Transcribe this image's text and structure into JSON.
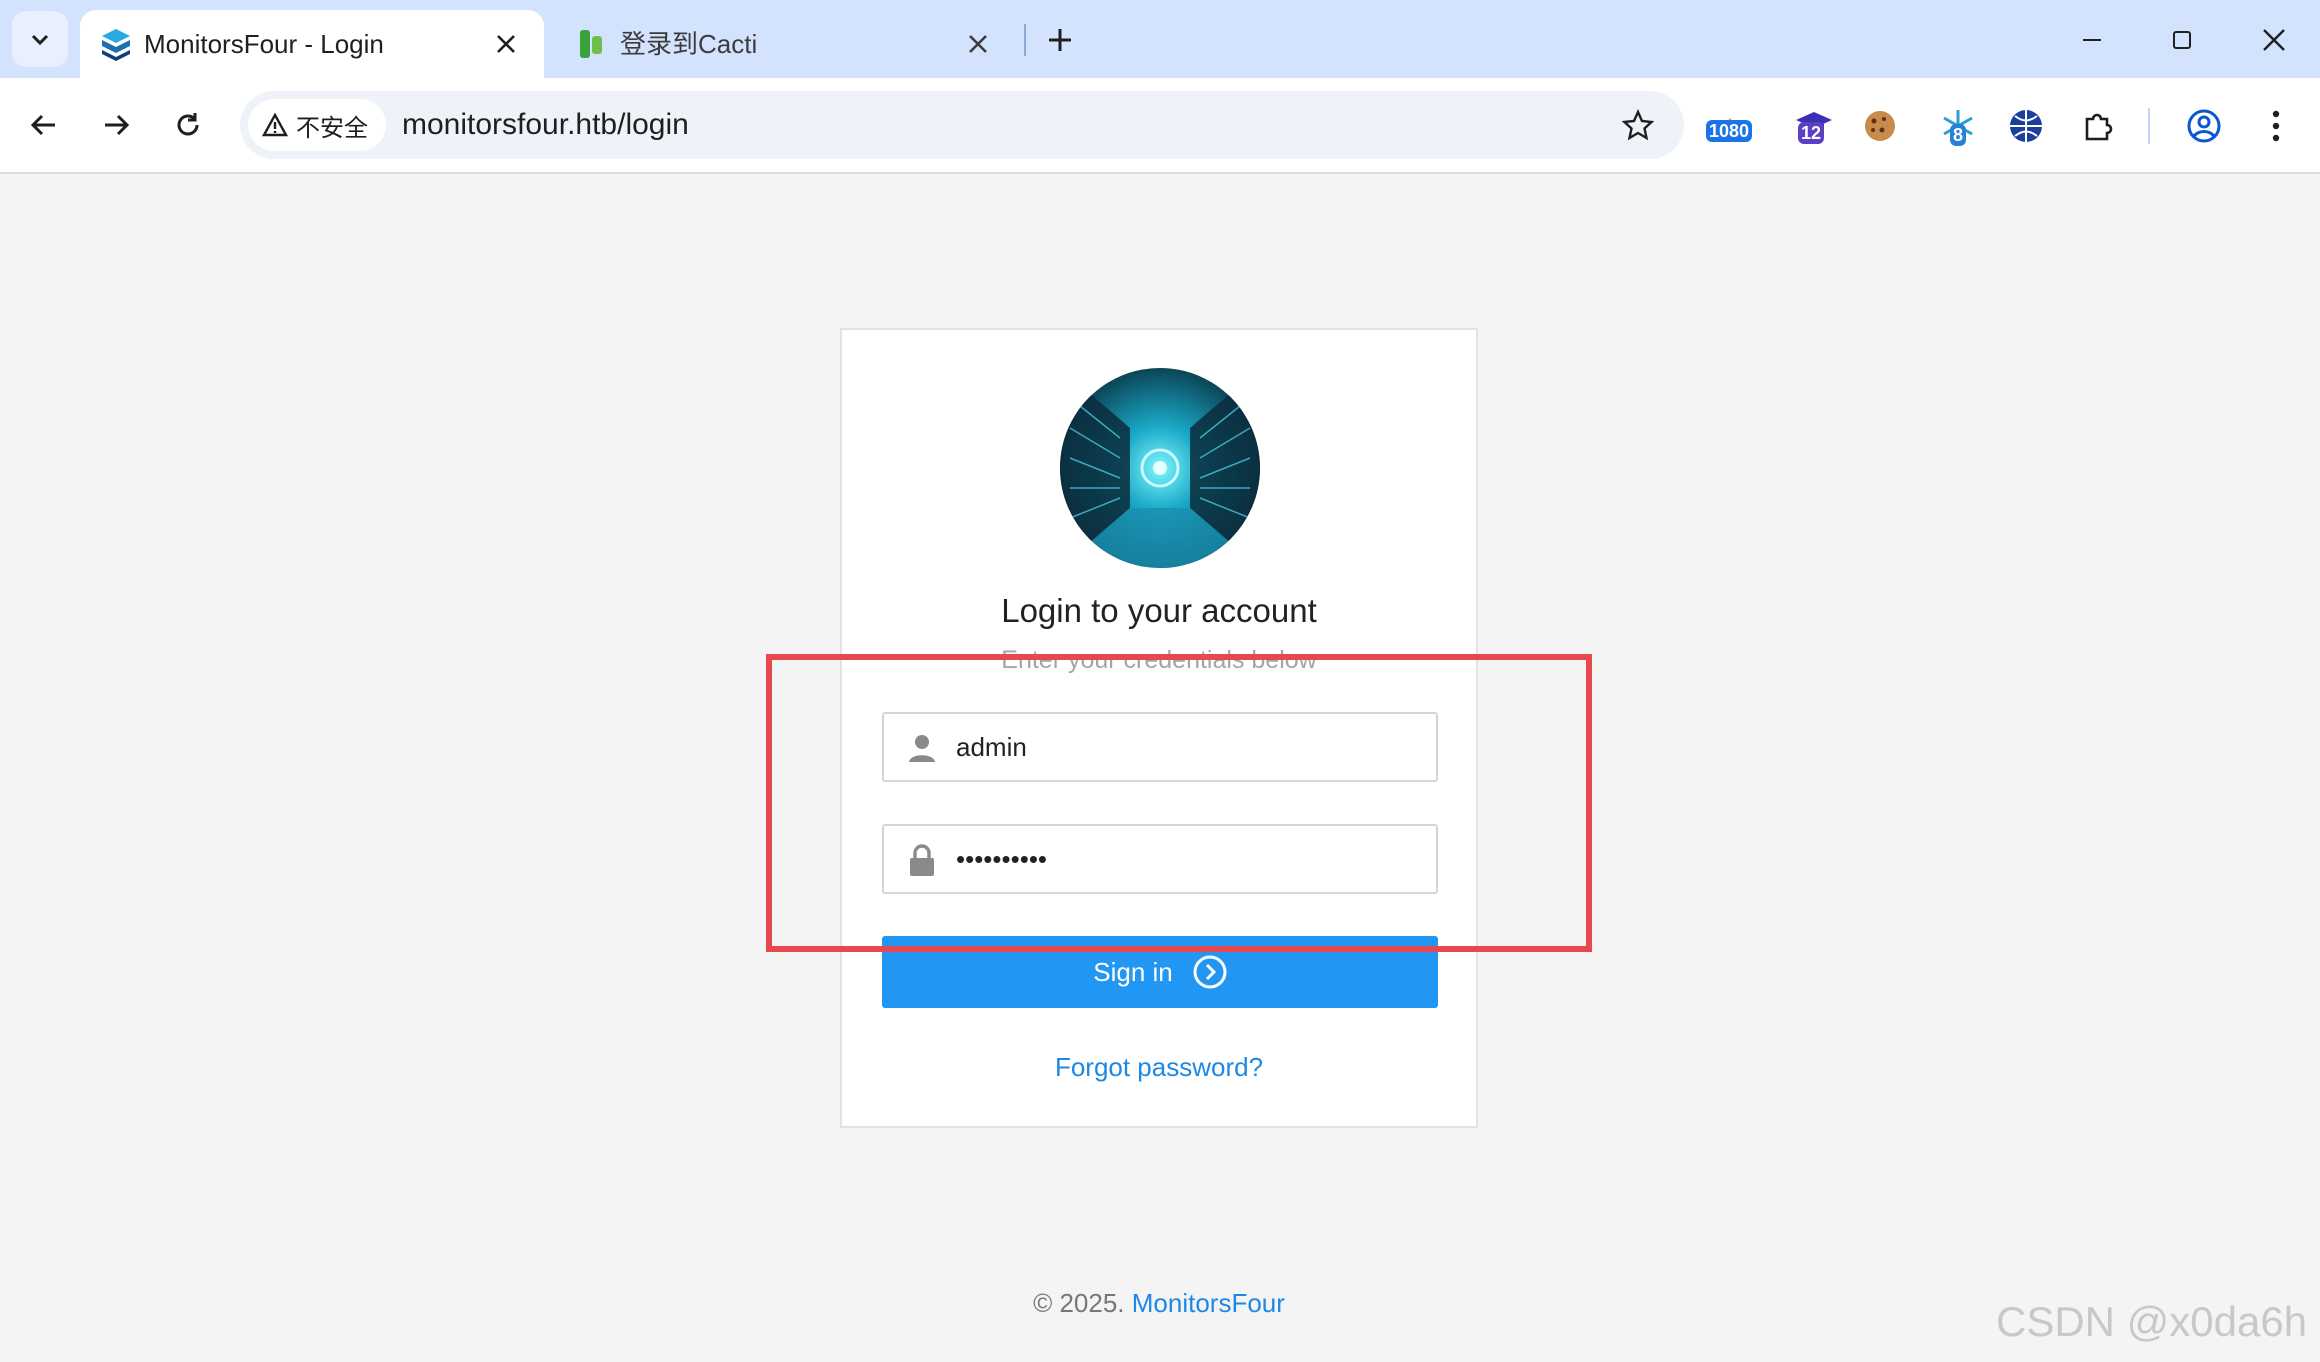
{
  "browser": {
    "tabs": [
      {
        "title": "MonitorsFour - Login",
        "active": true
      },
      {
        "title": "登录到Cacti",
        "active": false
      }
    ],
    "security_chip": "不安全",
    "url": "monitorsfour.htb/login",
    "extensions": [
      {
        "icon": "wappalyzer-icon",
        "badge": "1080"
      },
      {
        "icon": "graduation-cap-icon",
        "badge": "12"
      },
      {
        "icon": "cookie-icon",
        "badge": ""
      },
      {
        "icon": "snowflake-icon",
        "badge": "8"
      },
      {
        "icon": "globe-icon",
        "badge": ""
      }
    ]
  },
  "login": {
    "heading": "Login to your account",
    "subheading": "Enter your credentials below",
    "username_value": "admin",
    "password_value": "••••••••••",
    "signin_label": "Sign in",
    "forgot_label": "Forgot password?"
  },
  "footer": {
    "copyright": "© 2025.",
    "brand": "MonitorsFour"
  },
  "watermark": "CSDN @x0da6h",
  "colors": {
    "primary": "#2196f3",
    "link": "#1e88e5",
    "annotation": "#e8474d",
    "tabstrip": "#d3e3fd"
  }
}
